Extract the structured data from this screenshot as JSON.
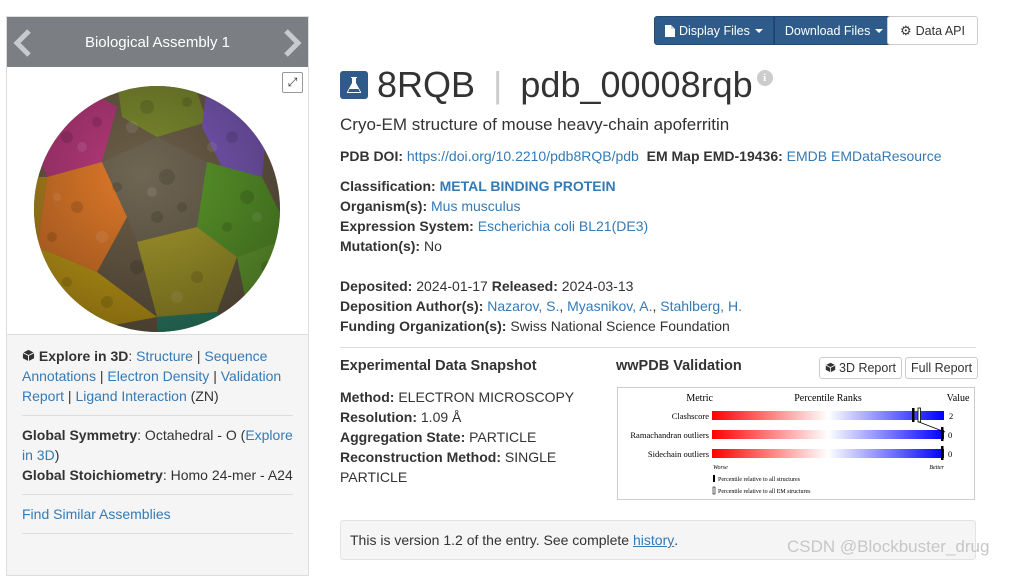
{
  "assembly": {
    "title": "Biological Assembly 1",
    "explore_label": "Explore in 3D",
    "links": [
      "Structure",
      "Sequence Annotations",
      "Electron Density",
      "Validation Report",
      "Ligand Interaction"
    ],
    "ligand": "(ZN)",
    "symmetry_label": "Global Symmetry",
    "symmetry_value": ": Octahedral - O",
    "symmetry_link": "Explore in 3D",
    "stoich_label": "Global Stoichiometry",
    "stoich_value": ": Homo 24-mer - A24",
    "find_similar": "Find Similar Assemblies"
  },
  "toolbar": {
    "display_files": "Display Files",
    "download_files": "Download Files",
    "data_api": "Data API"
  },
  "entry": {
    "id": "8RQB",
    "separator": "|",
    "alt_id": "pdb_00008rqb",
    "description": "Cryo-EM structure of mouse heavy-chain apoferritin",
    "doi_label": "PDB DOI:",
    "doi": "https://doi.org/10.2210/pdb8RQB/pdb",
    "emmap_label": "EM Map EMD-19436:",
    "emdb": "EMDB",
    "emdr": "EMDataResource",
    "classification_label": "Classification:",
    "classification": "METAL BINDING PROTEIN",
    "organism_label": "Organism(s):",
    "organism": "Mus musculus",
    "expression_label": "Expression System:",
    "expression": "Escherichia coli BL21(DE3)",
    "mutation_label": "Mutation(s):",
    "mutation": "No",
    "deposited_label": "Deposited:",
    "deposited": "2024-01-17",
    "released_label": "Released:",
    "released": "2024-03-13",
    "authors_label": "Deposition Author(s):",
    "authors": [
      "Nazarov, S.",
      "Myasnikov, A.",
      "Stahlberg, H."
    ],
    "funding_label": "Funding Organization(s):",
    "funding": "Swiss National Science Foundation"
  },
  "snapshot": {
    "title": "Experimental Data Snapshot",
    "method_label": "Method:",
    "method": "ELECTRON MICROSCOPY",
    "resolution_label": "Resolution:",
    "resolution": "1.09 Å",
    "aggregation_label": "Aggregation State:",
    "aggregation": "PARTICLE",
    "reconstruction_label": "Reconstruction Method:",
    "reconstruction": "SINGLE PARTICLE"
  },
  "validation": {
    "title": "wwPDB Validation",
    "report_3d": "3D Report",
    "full_report": "Full Report",
    "header_metric": "Metric",
    "header_ranks": "Percentile Ranks",
    "header_value": "Value",
    "metrics": [
      {
        "name": "Clashscore",
        "value": "2"
      },
      {
        "name": "Ramachandran outliers",
        "value": "0"
      },
      {
        "name": "Sidechain outliers",
        "value": "0"
      }
    ],
    "worse": "Worse",
    "better": "Better",
    "legend_all": "Percentile relative to all structures",
    "legend_em": "Percentile relative to all EM structures"
  },
  "history": {
    "text": "This is version 1.2 of the entry. See complete",
    "link": "history",
    "end": "."
  },
  "watermark": "CSDN @Blockbuster_drug",
  "colors": {
    "primary": "#2f5b8a",
    "link": "#337ab7"
  }
}
